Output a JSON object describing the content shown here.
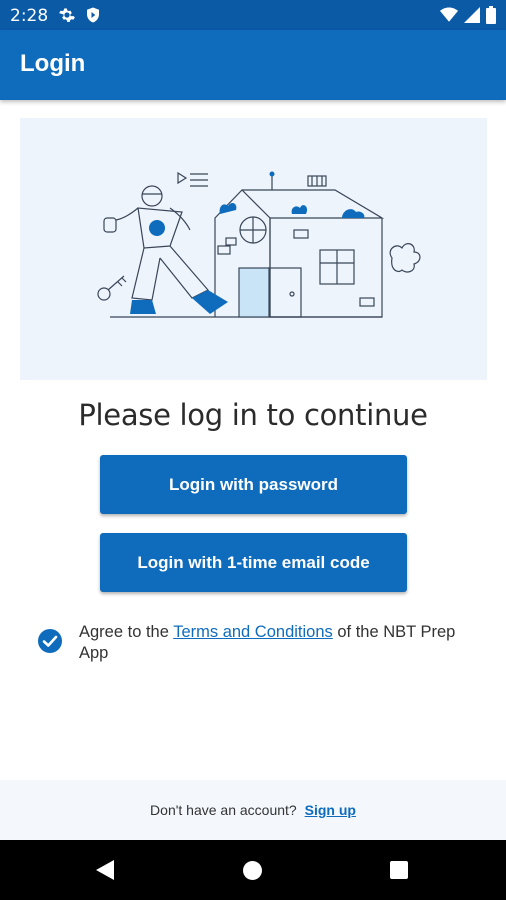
{
  "status_bar": {
    "time": "2:28",
    "icons_left": [
      "gear-icon",
      "shield-icon"
    ],
    "icons_right": [
      "wifi-icon",
      "signal-icon",
      "battery-icon"
    ]
  },
  "app_bar": {
    "title": "Login"
  },
  "hero": {
    "illustration": "worker-thumbs-up-house-illustration"
  },
  "heading": "Please log in to continue",
  "buttons": {
    "password": "Login with password",
    "email_code": "Login with 1-time email code"
  },
  "agreement": {
    "checked": true,
    "prefix": "Agree to the ",
    "link": "Terms and Conditions",
    "suffix": " of the NBT Prep App"
  },
  "footer": {
    "prompt": "Don't have an account?",
    "signup": "Sign up"
  },
  "colors": {
    "primary": "#0f6cbd",
    "status_bar": "#0a5aa6",
    "hero_bg": "#edf4fc",
    "footer_bg": "#f4f8fd"
  }
}
